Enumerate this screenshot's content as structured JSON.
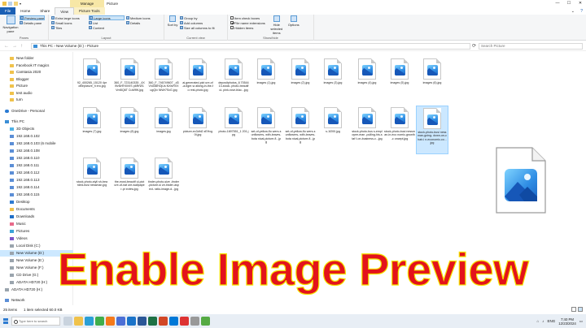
{
  "window": {
    "context_tab": "Manage",
    "title": "Picture",
    "controls": [
      "—",
      "☐",
      "✕"
    ]
  },
  "ribbon_tabs": [
    "File",
    "Home",
    "Share",
    "View",
    "Picture Tools"
  ],
  "ribbon": {
    "panes": {
      "nav_pane": "Navigation pane",
      "preview_pane": "Preview pane",
      "details_pane": "Details pane",
      "label": "Panes"
    },
    "layout": {
      "items": [
        "Extra large icons",
        "Large icons",
        "Medium icons",
        "Small icons",
        "List",
        "Details",
        "Tiles",
        "Content"
      ],
      "selected": "Large icons",
      "label": "Layout"
    },
    "current_view": {
      "group_by": "Group by",
      "add_columns": "Add columns",
      "size_all_columns": "Size all columns to fit",
      "sort_by": "Sort by",
      "label": "Current view"
    },
    "show_hide": {
      "item_check_boxes": "Item check boxes",
      "file_name_extensions": "File name extensions",
      "hidden_items": "Hidden items",
      "hide_selected": "Hide selected items",
      "options": "Options",
      "label": "Show/hide"
    }
  },
  "address": {
    "path": "This PC  ›  New Volume (D:)  ›  Picture",
    "search_placeholder": "Search Picture"
  },
  "nav_pane": {
    "items": [
      {
        "label": "New folder",
        "icon": "folder"
      },
      {
        "label": "Facebook IT magics",
        "icon": "folder"
      },
      {
        "label": "Camtasia 2020",
        "icon": "folder"
      },
      {
        "label": "Blogger",
        "icon": "folder"
      },
      {
        "label": "Picture",
        "icon": "folder"
      },
      {
        "label": "test audio",
        "icon": "folder"
      },
      {
        "label": "turn",
        "icon": "folder"
      },
      {
        "label": "OneDrive - Personal",
        "icon": "onedrive"
      },
      {
        "label": "This PC",
        "icon": "pc"
      },
      {
        "label": "3D Objects",
        "icon": "obj"
      },
      {
        "label": "192.168.0.102",
        "icon": "net"
      },
      {
        "label": "192.168.0.103 (6 mobile",
        "icon": "net"
      },
      {
        "label": "192.168.0.108",
        "icon": "net"
      },
      {
        "label": "192.168.0.110",
        "icon": "net"
      },
      {
        "label": "192.168.0.111",
        "icon": "net"
      },
      {
        "label": "192.168.0.112",
        "icon": "net"
      },
      {
        "label": "192.168.0.113",
        "icon": "net"
      },
      {
        "label": "192.168.0.114",
        "icon": "net"
      },
      {
        "label": "192.168.0.115",
        "icon": "net"
      },
      {
        "label": "Desktop",
        "icon": "desk"
      },
      {
        "label": "Documents",
        "icon": "folder"
      },
      {
        "label": "Downloads",
        "icon": "dl"
      },
      {
        "label": "Music",
        "icon": "music"
      },
      {
        "label": "Pictures",
        "icon": "pict"
      },
      {
        "label": "Videos",
        "icon": "video"
      },
      {
        "label": "Local Disk (C:)",
        "icon": "drive"
      },
      {
        "label": "New Volume (D:)",
        "icon": "drive",
        "selected": true
      },
      {
        "label": "New Volume (E:)",
        "icon": "drive"
      },
      {
        "label": "New Volume (F:)",
        "icon": "drive"
      },
      {
        "label": "CD Drive (G:)",
        "icon": "drive"
      },
      {
        "label": "ADATA HD720 (H:)",
        "icon": "drive"
      },
      {
        "label": "ADATA HD720 (H:)",
        "icon": "drive"
      },
      {
        "label": "Network",
        "icon": "net"
      }
    ]
  },
  "files": [
    {
      "name": "92_400265_15120 4profilepicture_h ero.jpg"
    },
    {
      "name": "360_F_723140335 _4Xl9vfzHHXiVIS p6RrW1VmBQ6T CuWfW.jpg"
    },
    {
      "name": "360_F_746749607 _d3VI4l3BHOjUs NXlvRVXugQIx NiWr7SxG.jpg"
    },
    {
      "name": "ai-generated-pict ure-of-a-tiger-w alking-in-the-fo rest-photo.jpg"
    },
    {
      "name": "depositphotos_6 7054413-stock- photo-beautiful- pink-rose-blac...jpg"
    },
    {
      "name": "images (1).jpg"
    },
    {
      "name": "images (2).jpg"
    },
    {
      "name": "images (3).jpg"
    },
    {
      "name": "images (4).jpg"
    },
    {
      "name": "images (5).jpg"
    },
    {
      "name": "images (6).jpg"
    },
    {
      "name": "images (7).jpg"
    },
    {
      "name": "images (8).jpg"
    },
    {
      "name": "images.jpg"
    },
    {
      "name": "picture-ex3dhi2 zEHxg0t.jpg"
    },
    {
      "name": "photo-1697551_1 201.jpg"
    },
    {
      "name": "set-of-yellow-flo wers-sunflowers- with-leaves-bota nical-picture-fl...jpg"
    },
    {
      "name": "set-of-yellow-flo wers-sunflowers- with-leaves-bota nical-picture-fl...jpg"
    },
    {
      "name": "s-1f200.jpg"
    },
    {
      "name": "stock-photo-bus s-employee-man -pulling-his-staf f-on-business-c...jpg"
    },
    {
      "name": "stock-photo-busi nessman-in-eco nomic-growth-c oncept.jpg"
    },
    {
      "name": "stock-photo-busi nessman-going- down-on-chair-i n-economic-co...jpg",
      "selected": true
    },
    {
      "name": "stock-photo-styli sh-bearded-busi nessman.jpg"
    },
    {
      "name": "the-most-beautif ul-picture-of-nat ure-wallpaper-pr eview.jpg"
    },
    {
      "name": "tinder-photo-size -tinder-picture-si ze-tinder-aspect- ratio-image-d...jpg"
    }
  ],
  "preview_icon": "image-file-icon",
  "banner": "Enable Image Preview",
  "status": {
    "count": "25 items",
    "selected": "1 item selected  60.0 KB"
  },
  "taskbar": {
    "search_placeholder": "Type here to search",
    "lang": "ENG",
    "time": "7:40 PM",
    "date": "12/23/2024"
  },
  "colors": {
    "accent": "#1a5fb4",
    "selection": "#cce8ff",
    "banner_text": "#e3131b",
    "banner_outline": "#f5e400",
    "manage_tab": "#f7e7a6"
  }
}
